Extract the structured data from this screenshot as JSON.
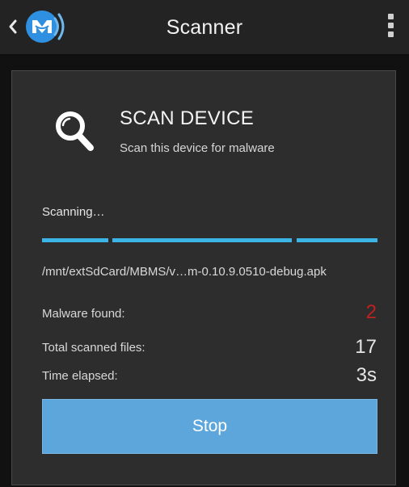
{
  "header": {
    "title": "Scanner"
  },
  "card": {
    "title": "SCAN DEVICE",
    "subtitle": "Scan this device for malware",
    "status": "Scanning…",
    "current_file": "/mnt/extSdCard/MBMS/v…m-0.10.9.0510-debug.apk"
  },
  "stats": {
    "malware_label": "Malware found:",
    "malware_value": "2",
    "files_label": "Total scanned files:",
    "files_value": "17",
    "time_label": "Time elapsed:",
    "time_value": "3s"
  },
  "actions": {
    "stop_label": "Stop"
  },
  "icons": {
    "back": "chevron-left-icon",
    "logo": "malwarebytes-logo",
    "menu": "overflow-menu-icon",
    "scan": "magnifier-icon"
  },
  "colors": {
    "accent": "#3db4e6",
    "button": "#5da6db",
    "malware_count": "#c0211f",
    "card_bg": "#2d2d2d",
    "bar_bg": "#232323"
  }
}
